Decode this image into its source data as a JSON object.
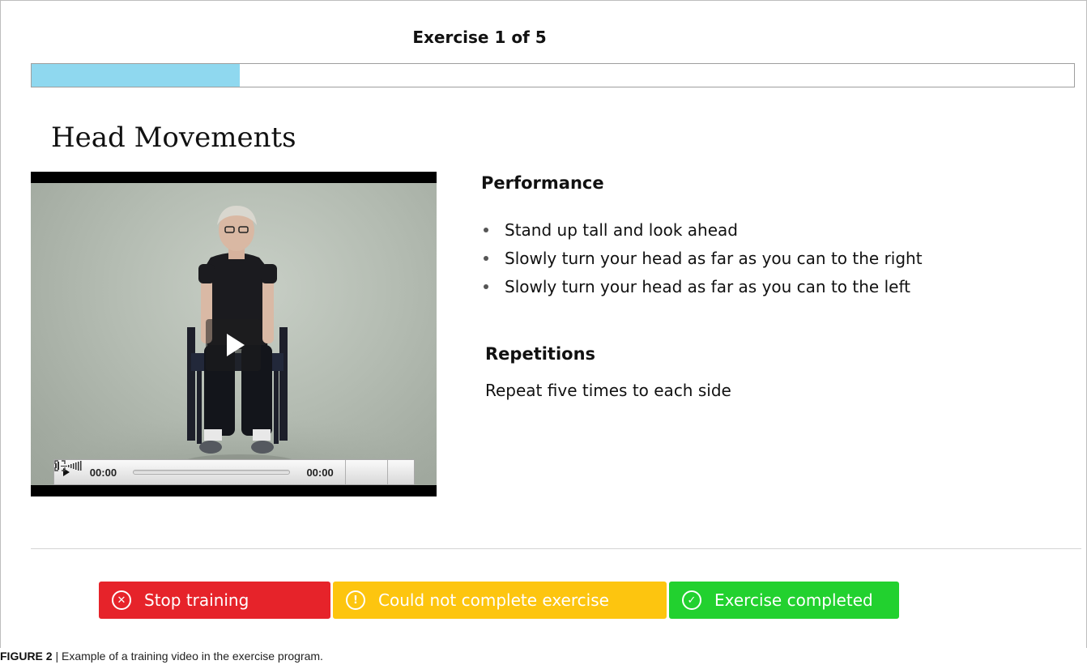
{
  "header": {
    "exercise_counter": "Exercise 1 of 5",
    "progress_fraction": 0.2,
    "progress_color": "#8fd8ef"
  },
  "exercise": {
    "title": "Head Movements",
    "performance_heading": "Performance",
    "performance_steps": [
      "Stand up tall and look ahead",
      "Slowly turn your head as far as you can to the right",
      "Slowly turn your head as far as you can to the left"
    ],
    "repetitions_heading": "Repetitions",
    "repetitions_text": "Repeat five times to each side"
  },
  "video": {
    "current_time": "00:00",
    "duration": "00:00",
    "icons": [
      "play-icon",
      "volume-icon",
      "fullscreen-icon"
    ]
  },
  "actions": {
    "stop_label": "Stop training",
    "stop_icon": "x-circle-icon",
    "stop_color": "#e6232a",
    "could_not_label": "Could not complete exercise",
    "could_not_icon": "exclamation-circle-icon",
    "could_not_color": "#fdc50f",
    "completed_label": "Exercise completed",
    "completed_icon": "check-circle-icon",
    "completed_color": "#22d12f"
  },
  "caption": {
    "label": "FIGURE 2",
    "text": " | Example of a training video in the exercise program."
  }
}
